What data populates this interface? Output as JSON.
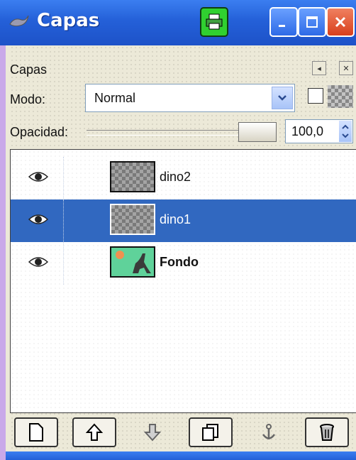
{
  "window": {
    "title": "Capas",
    "icons": {
      "title": "gimp-wilber-icon",
      "print": "printer-icon",
      "minimize": "minimize-icon",
      "maximize": "maximize-icon",
      "close": "close-icon"
    },
    "colors": {
      "titlebar": "#2460d8",
      "close": "#d8401c",
      "print_button": "#30d030"
    }
  },
  "dock": {
    "title": "Capas",
    "icons": {
      "menu": "dock-menu-icon",
      "close": "dock-close-icon"
    }
  },
  "controls": {
    "mode_label": "Modo:",
    "mode_value": "Normal",
    "keep_transparency_icon": "checkerboard-alpha-icon",
    "opacity_label": "Opacidad:",
    "opacity_value": "100,0",
    "opacity_percent": 100
  },
  "layers": [
    {
      "name": "dino2",
      "visible_icon": "eye-icon",
      "selected": false,
      "bold": false
    },
    {
      "name": "dino1",
      "visible_icon": "eye-icon",
      "selected": true,
      "bold": false
    },
    {
      "name": "Fondo",
      "visible_icon": "eye-icon",
      "selected": false,
      "bold": true
    }
  ],
  "toolbar": {
    "icons": [
      "new-layer-icon",
      "raise-layer-icon",
      "lower-layer-icon",
      "duplicate-layer-icon",
      "anchor-layer-icon",
      "delete-layer-icon"
    ]
  },
  "selection_color": "#3168c0"
}
